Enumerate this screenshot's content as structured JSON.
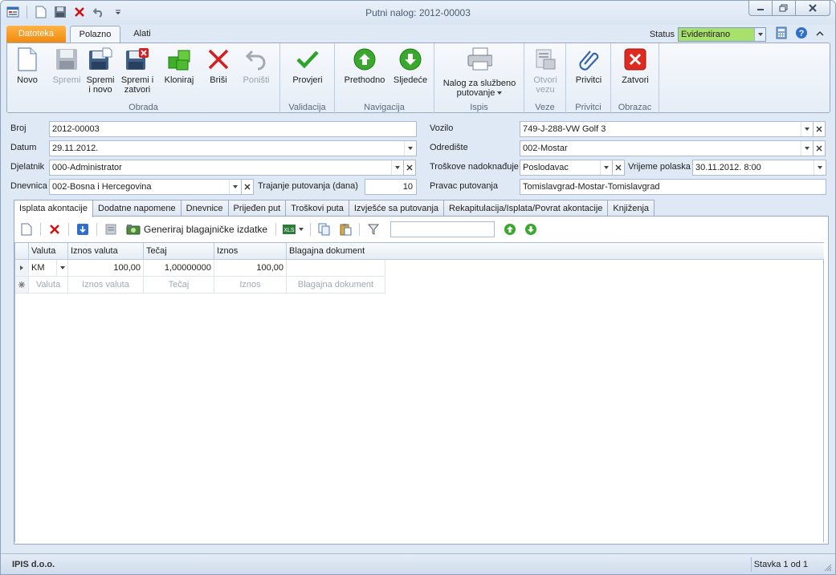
{
  "window": {
    "title": "Putni nalog: 2012-00003"
  },
  "ribbon_tabs": {
    "file": "Datoteka",
    "home": "Polazno",
    "tools": "Alati"
  },
  "status": {
    "label": "Status",
    "value": "Evidentirano",
    "value_color": "#a8e06c"
  },
  "ribbon": {
    "groups": {
      "obrada": "Obrada",
      "validacija": "Validacija",
      "navigacija": "Navigacija",
      "ispis": "Ispis",
      "veze": "Veze",
      "privitci": "Privitci",
      "obrazac": "Obrazac"
    },
    "buttons": {
      "novo": "Novo",
      "spremi": "Spremi",
      "spremi_novo_1": "Spremi",
      "spremi_novo_2": "i novo",
      "spremi_zatvori_1": "Spremi i",
      "spremi_zatvori_2": "zatvori",
      "kloniraj": "Kloniraj",
      "brisi": "Briši",
      "ponisti": "Poništi",
      "provjeri": "Provjeri",
      "prethodno": "Prethodno",
      "sljedece": "Sljedeće",
      "nalog_1": "Nalog za službeno",
      "nalog_2": "putovanje",
      "otvori_1": "Otvori",
      "otvori_2": "vezu",
      "privitci": "Privitci",
      "zatvori": "Zatvori"
    }
  },
  "form": {
    "broj": {
      "label": "Broj",
      "value": "2012-00003"
    },
    "datum": {
      "label": "Datum",
      "value": "29.11.2012."
    },
    "djelatnik": {
      "label": "Djelatnik",
      "value": "000-Administrator"
    },
    "dnevnica": {
      "label": "Dnevnica",
      "value": "002-Bosna i Hercegovina"
    },
    "trajanje": {
      "label": "Trajanje putovanja (dana)",
      "value": "10"
    },
    "vozilo": {
      "label": "Vozilo",
      "value": "749-J-288-VW Golf 3"
    },
    "odrediste": {
      "label": "Odredište",
      "value": "002-Mostar"
    },
    "troskove": {
      "label": "Troškove nadoknađuje",
      "value": "Poslodavac"
    },
    "vrijeme": {
      "label": "Vrijeme polaska",
      "value": "30.11.2012. 8:00"
    },
    "pravac": {
      "label": "Pravac putovanja",
      "value": "Tomislavgrad-Mostar-Tomislavgrad"
    }
  },
  "tabs": [
    "Isplata akontacije",
    "Dodatne napomene",
    "Dnevnice",
    "Prijeđen put",
    "Troškovi puta",
    "Izvješće sa putovanja",
    "Rekapitulacija/Isplata/Povrat akontacije",
    "Knjiženja"
  ],
  "grid_toolbar": {
    "generate_label": "Generiraj blagajničke izdatke",
    "search_value": ""
  },
  "grid": {
    "columns": [
      "Valuta",
      "Iznos valuta",
      "Tečaj",
      "Iznos",
      "Blagajna dokument"
    ],
    "rows": [
      {
        "valuta": "KM",
        "iznos_valuta": "100,00",
        "tecaj": "1,00000000",
        "iznos": "100,00",
        "blagajna": ""
      }
    ]
  },
  "statusbar": {
    "company": "IPIS d.o.o.",
    "record": "Stavka 1 od 1"
  }
}
